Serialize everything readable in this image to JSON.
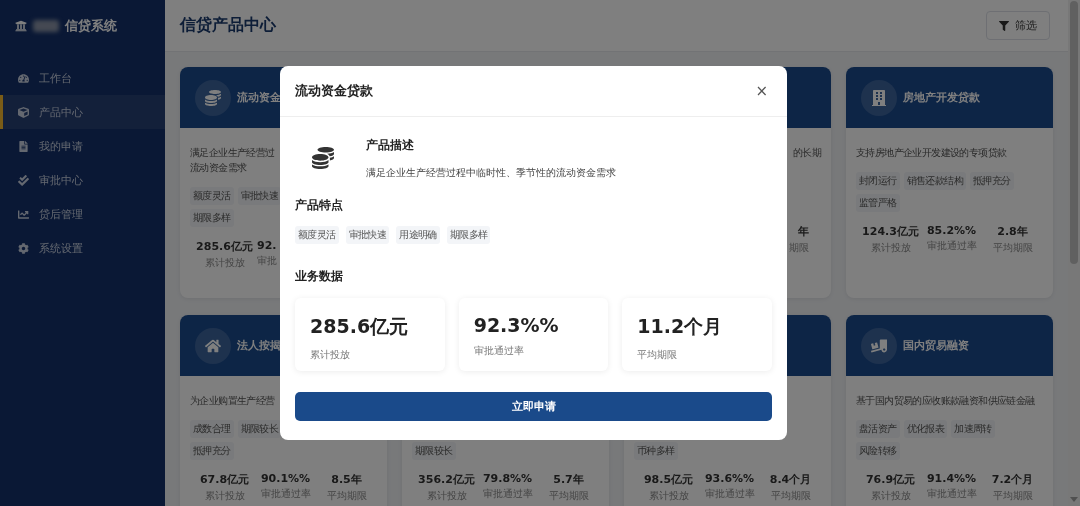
{
  "sidebar": {
    "brand": "信贷系统",
    "items": [
      {
        "label": "工作台",
        "selected": false
      },
      {
        "label": "产品中心",
        "selected": true
      },
      {
        "label": "我的申请",
        "selected": false
      },
      {
        "label": "审批中心",
        "selected": false
      },
      {
        "label": "贷后管理",
        "selected": false
      },
      {
        "label": "系统设置",
        "selected": false
      }
    ]
  },
  "header": {
    "title": "信贷产品中心",
    "filter_button": "筛选"
  },
  "products": [
    {
      "title": "流动资金",
      "description_lines": [
        "满足企业生产经营过",
        "流动资金需求"
      ],
      "tag_rows": [
        [
          "额度灵活",
          "审批快速"
        ],
        [
          "期限多样"
        ]
      ],
      "stats": [
        {
          "value": "285.6亿元",
          "label": "累计投放",
          "cut": false
        },
        {
          "value": "92.",
          "label": "审批",
          "cut": true
        }
      ]
    },
    {
      "description_lines": [
        "的长期"
      ],
      "stats": [
        {
          "value": "年",
          "label": "期限",
          "cut": true
        }
      ]
    },
    {
      "title": "房地产开发贷款",
      "description_lines": [
        "支持房地产企业开发建设的专项贷款"
      ],
      "tag_rows": [
        [
          "封闭运行",
          "销售还款结构",
          "抵押充分"
        ],
        [
          "监管严格"
        ]
      ],
      "stats": [
        {
          "value": "124.3亿元",
          "label": "累计投放",
          "cut": false
        },
        {
          "value": "85.2%%",
          "label": "审批通过率",
          "cut": false
        },
        {
          "value": "2.8年",
          "label": "平均期限",
          "cut": false
        }
      ]
    },
    {
      "title": "法人按揭",
      "description_lines": [
        "为企业购置生产经营"
      ],
      "tag_rows": [
        [
          "成数合理",
          "期限较长"
        ],
        [
          "抵押充分"
        ]
      ],
      "stats": [
        {
          "value": "67.8亿元",
          "label": "累计投放",
          "cut": false
        },
        {
          "value": "90.1%%",
          "label": "审批通过率",
          "cut": false
        },
        {
          "value": "8.5年",
          "label": "平均期限",
          "cut": false
        }
      ]
    },
    {
      "tag_rows": [
        [
          "期限较长"
        ]
      ],
      "stats": [
        {
          "value": "356.2亿元",
          "label": "累计投放",
          "cut": false
        },
        {
          "value": "79.8%%",
          "label": "审批通过率",
          "cut": false
        },
        {
          "value": "5.7年",
          "label": "平均期限",
          "cut": false
        }
      ]
    },
    {
      "tag_rows": [
        [
          "币种多样"
        ]
      ],
      "stats": [
        {
          "value": "98.5亿元",
          "label": "累计投放",
          "cut": false
        },
        {
          "value": "93.6%%",
          "label": "审批通过率",
          "cut": false
        },
        {
          "value": "8.4个月",
          "label": "平均期限",
          "cut": false
        }
      ]
    },
    {
      "title": "国内贸易融资",
      "description_lines": [
        "基于国内贸易的应收账款融资和供应链金融"
      ],
      "tag_rows": [
        [
          "盘活资产",
          "优化报表",
          "加速周转"
        ],
        [
          "风险转移"
        ]
      ],
      "stats": [
        {
          "value": "76.9亿元",
          "label": "累计投放",
          "cut": false
        },
        {
          "value": "91.4%%",
          "label": "审批通过率",
          "cut": false
        },
        {
          "value": "7.2个月",
          "label": "平均期限",
          "cut": false
        }
      ]
    }
  ],
  "modal": {
    "title": "流动资金贷款",
    "close": "×",
    "description_heading": "产品描述",
    "description": "满足企业生产经营过程中临时性、季节性的流动资金需求",
    "features_heading": "产品特点",
    "features": [
      "额度灵活",
      "审批快速",
      "用途明确",
      "期限多样"
    ],
    "data_heading": "业务数据",
    "stats": [
      {
        "value": "285.6亿元",
        "label": "累计投放"
      },
      {
        "value": "92.3%%",
        "label": "审批通过率"
      },
      {
        "value": "11.2个月",
        "label": "平均期限"
      }
    ],
    "apply_button": "立即申请"
  }
}
